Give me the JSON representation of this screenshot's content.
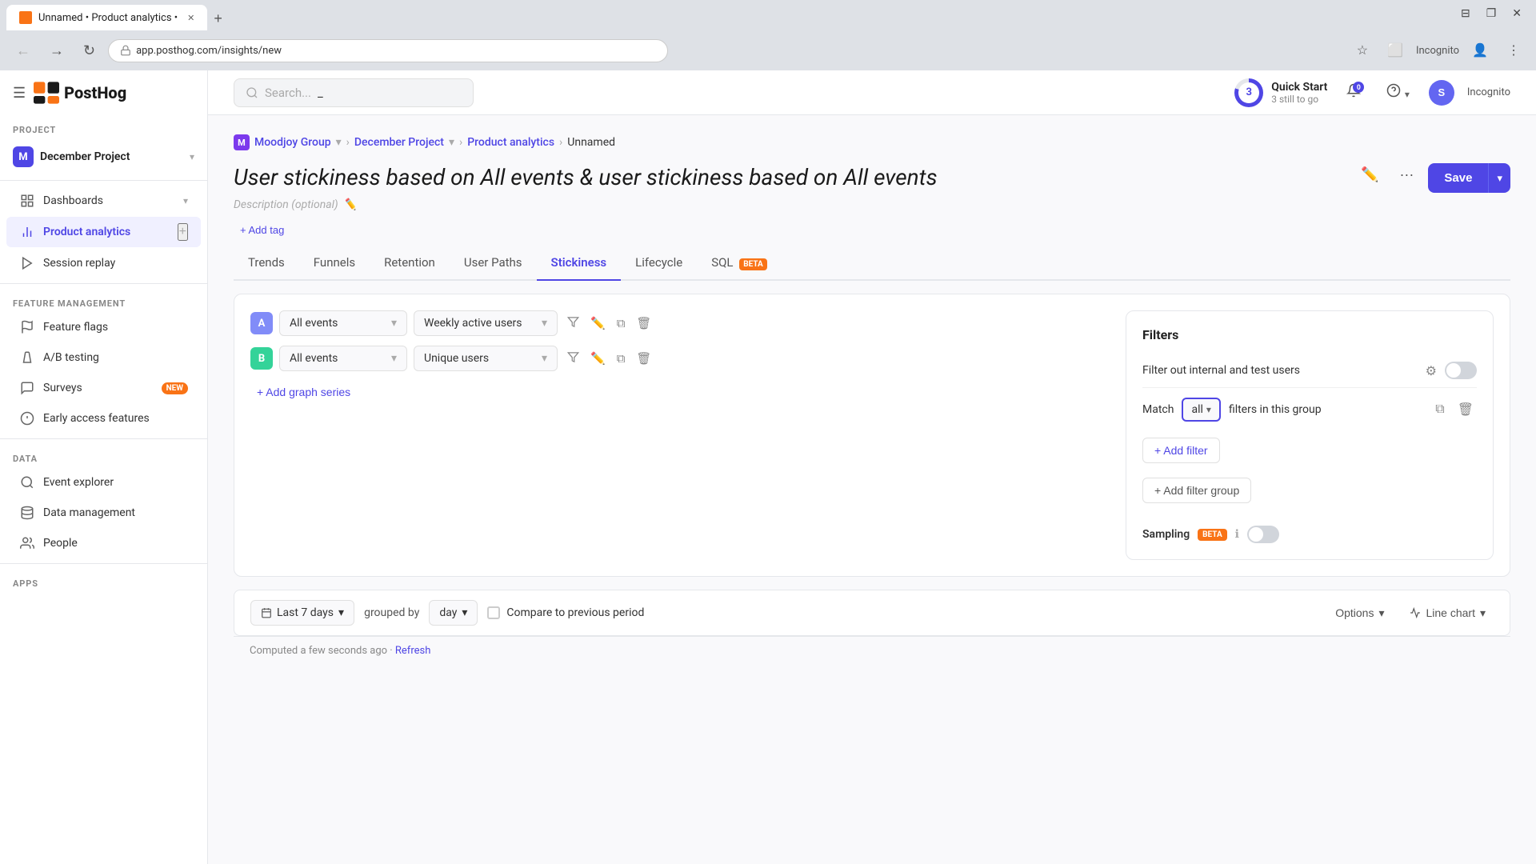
{
  "browser": {
    "tab_title": "Unnamed • Product analytics •",
    "url": "app.posthog.com/insights/new",
    "incognito_label": "Incognito"
  },
  "topbar": {
    "search_placeholder": "Search...",
    "quick_start_label": "Quick Start",
    "quick_start_sub": "3 still to go",
    "quick_start_number": "3",
    "notification_count": "0"
  },
  "sidebar": {
    "project_label": "PROJECT",
    "project_name": "December Project",
    "project_initial": "M",
    "nav": [
      {
        "id": "dashboards",
        "label": "Dashboards",
        "icon": "grid"
      },
      {
        "id": "product-analytics",
        "label": "Product analytics",
        "icon": "chart",
        "active": true,
        "has_add": true
      },
      {
        "id": "session-replay",
        "label": "Session replay",
        "icon": "play"
      }
    ],
    "feature_management_label": "FEATURE MANAGEMENT",
    "feature_nav": [
      {
        "id": "feature-flags",
        "label": "Feature flags",
        "icon": "flag"
      },
      {
        "id": "ab-testing",
        "label": "A/B testing",
        "icon": "flask"
      },
      {
        "id": "surveys",
        "label": "Surveys",
        "icon": "survey",
        "badge": "NEW"
      }
    ],
    "early_access": "Early access features",
    "data_label": "DATA",
    "data_nav": [
      {
        "id": "event-explorer",
        "label": "Event explorer",
        "icon": "event"
      },
      {
        "id": "data-management",
        "label": "Data management",
        "icon": "database"
      },
      {
        "id": "people",
        "label": "People",
        "icon": "people"
      }
    ],
    "apps_label": "APPS"
  },
  "breadcrumb": {
    "group": "Moodjoy Group",
    "project": "December Project",
    "section": "Product analytics",
    "current": "Unnamed"
  },
  "insight": {
    "title": "User stickiness based on All events & user stickiness based on All events",
    "description": "Description (optional)",
    "add_tag_label": "+ Add tag"
  },
  "tabs": [
    {
      "id": "trends",
      "label": "Trends"
    },
    {
      "id": "funnels",
      "label": "Funnels"
    },
    {
      "id": "retention",
      "label": "Retention"
    },
    {
      "id": "user-paths",
      "label": "User Paths"
    },
    {
      "id": "stickiness",
      "label": "Stickiness",
      "active": true
    },
    {
      "id": "lifecycle",
      "label": "Lifecycle"
    },
    {
      "id": "sql",
      "label": "SQL",
      "badge": "BETA"
    }
  ],
  "series": [
    {
      "id": "A",
      "event": "All events",
      "metric": "Weekly active users"
    },
    {
      "id": "B",
      "event": "All events",
      "metric": "Unique users"
    }
  ],
  "add_series_label": "+ Add graph series",
  "filters": {
    "title": "Filters",
    "internal_users_label": "Filter out internal and test users",
    "match_label": "Match",
    "match_value": "all",
    "match_suffix": "filters in this group",
    "add_filter_label": "+ Add filter",
    "add_filter_group_label": "+ Add filter group",
    "sampling_label": "Sampling",
    "sampling_badge": "BETA"
  },
  "bottom": {
    "date_range": "Last 7 days",
    "grouped_by_label": "grouped by",
    "group_value": "day",
    "compare_label": "Compare to previous period",
    "options_label": "Options",
    "chart_type_label": "Line chart"
  },
  "computed": "Computed a few seconds ago · Refresh",
  "buttons": {
    "save": "Save"
  }
}
